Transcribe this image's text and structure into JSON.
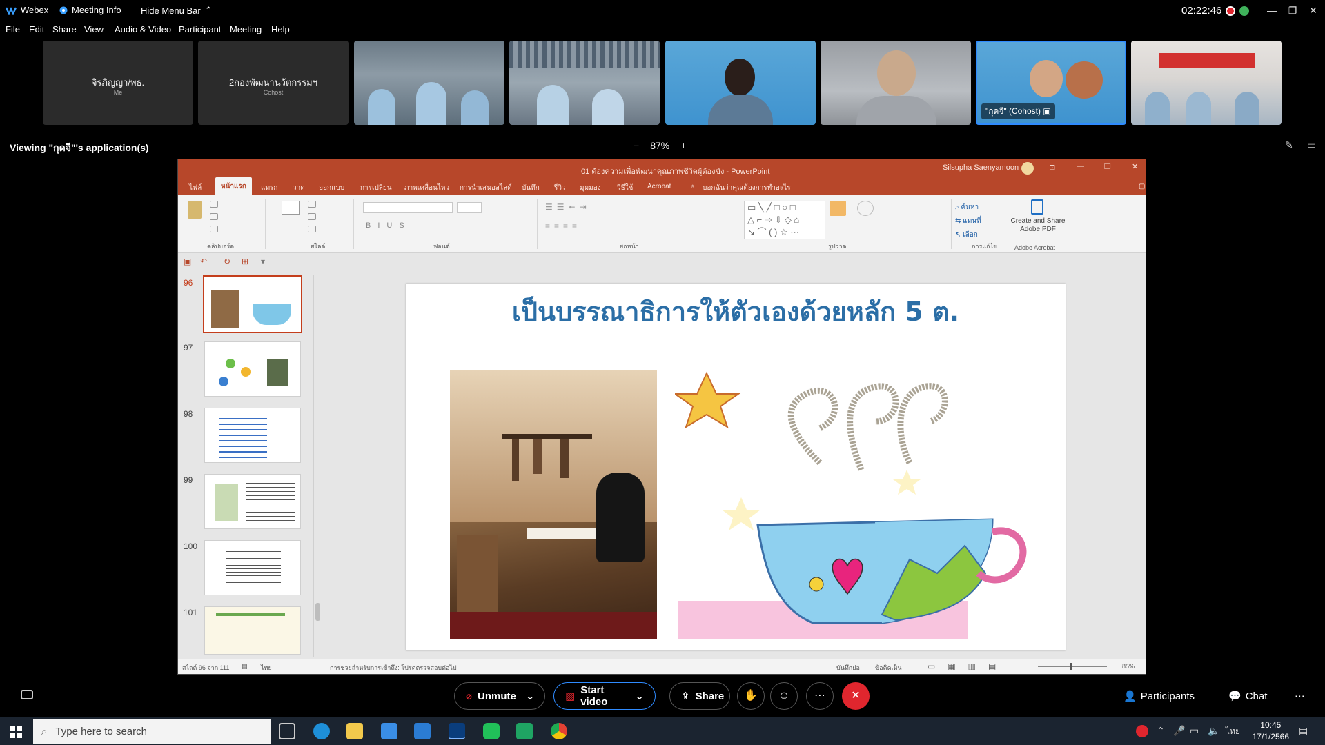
{
  "titlebar": {
    "app": "Webex",
    "meeting_info": "Meeting Info",
    "hide_menu": "Hide Menu Bar",
    "time": "02:22:46"
  },
  "menu": [
    "File",
    "Edit",
    "Share",
    "View",
    "Audio & Video",
    "Participant",
    "Meeting",
    "Help"
  ],
  "participants": [
    {
      "name": "จิรภิญญา/พธ.",
      "sub": "Me"
    },
    {
      "name": "2กองพัฒนานวัตกรรมฯ",
      "sub": "Cohost"
    },
    {
      "label": ""
    },
    {
      "label": ""
    },
    {
      "label": ""
    },
    {
      "label": ""
    },
    {
      "label": "\"กุดจี\" (Cohost)"
    },
    {
      "label": ""
    }
  ],
  "viewing": {
    "text": "Viewing \"กุดจี\"'s application(s)",
    "zoom": "87%",
    "minus": "−",
    "plus": "+"
  },
  "ppt": {
    "title": "01 ต้องความเพื่อพัฒนาคุณภาพชีวิตผู้ต้องขัง - PowerPoint",
    "user": "Silsupha Saenyamoon",
    "tabs": [
      "ไฟล์",
      "หน้าแรก",
      "แทรก",
      "วาด",
      "ออกแบบ",
      "การเปลี่ยน",
      "ภาพเคลื่อนไหว",
      "การนำเสนอสไลด์",
      "บันทึก",
      "รีวิว",
      "มุมมอง",
      "วิธีใช้",
      "Acrobat",
      "บอกฉันว่าคุณต้องการทำอะไร"
    ],
    "ribbon_groups": [
      "คลิปบอร์ด",
      "สไลด์",
      "ฟอนต์",
      "ย่อหน้า",
      "รูปวาด",
      "การแก้ไข",
      "Adobe Acrobat"
    ],
    "create_pdf": "Create and Share Adobe PDF",
    "slide_numbers": [
      "96",
      "97",
      "98",
      "99",
      "100",
      "101"
    ],
    "slide_title": "เป็นบรรณาธิการให้ตัวเองด้วยหลัก 5 ต.",
    "status_left": "สไลด์ 96 จาก 111",
    "status_lang": "ไทย",
    "status_note": "การช่วยสำหรับการเข้าถึง: โปรดตรวจสอบต่อไป",
    "status_notes_btn": "บันทึกย่อ",
    "status_comments": "ข้อคิดเห็น",
    "status_zoom": "85%"
  },
  "controls": {
    "unmute": "Unmute",
    "start_video": "Start video",
    "share": "Share",
    "participants": "Participants",
    "chat": "Chat"
  },
  "taskbar": {
    "search_placeholder": "Type here to search",
    "time": "10:45",
    "date": "17/1/2566",
    "lang": "ไทย"
  },
  "colors": {
    "ppt_accent": "#b7472a",
    "end_call": "#e0262e",
    "active_tile": "#2f8bff",
    "slide_title": "#2b6ea6"
  }
}
